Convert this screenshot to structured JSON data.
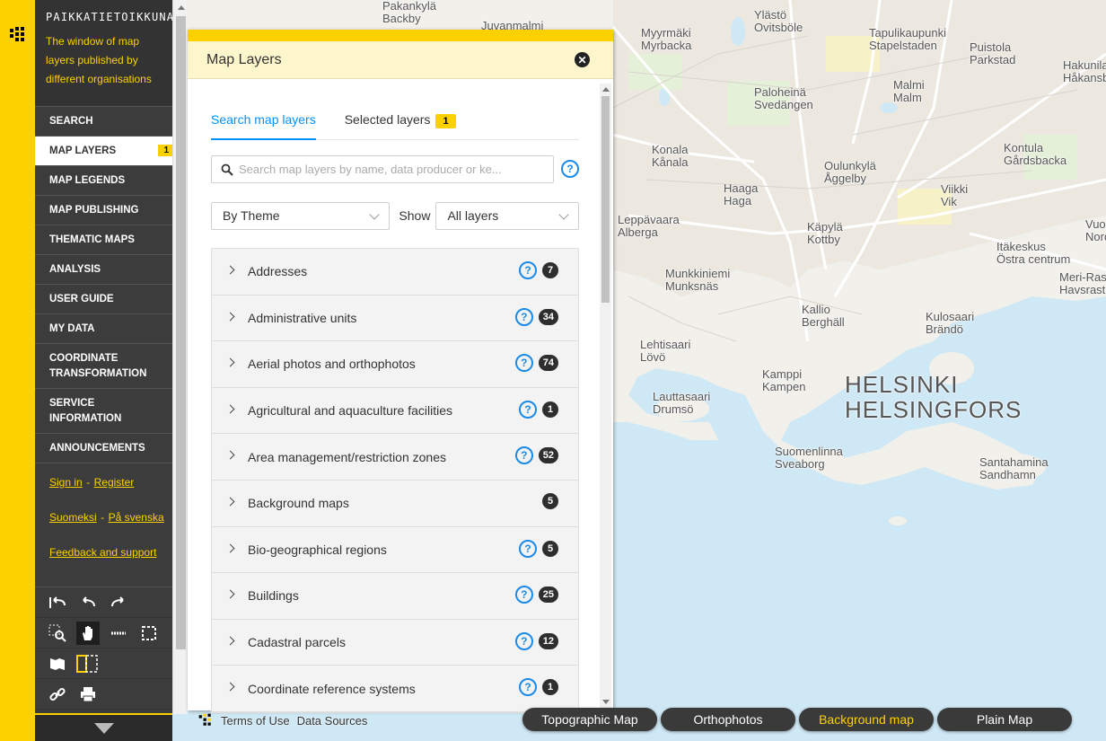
{
  "app": {
    "brand_title": "PAIKKATIETOIKKUNA",
    "brand_description": "The window of map layers published by different organisations"
  },
  "nav": {
    "items": [
      {
        "label": "SEARCH"
      },
      {
        "label": "MAP LAYERS",
        "badge": "1"
      },
      {
        "label": "MAP LEGENDS"
      },
      {
        "label": "MAP PUBLISHING"
      },
      {
        "label": "THEMATIC MAPS"
      },
      {
        "label": "ANALYSIS"
      },
      {
        "label": "USER GUIDE"
      },
      {
        "label": "MY DATA"
      },
      {
        "label": "COORDINATE TRANSFORMATION"
      },
      {
        "label": "SERVICE INFORMATION"
      },
      {
        "label": "ANNOUNCEMENTS"
      }
    ],
    "sign_in": "Sign in",
    "register": "Register",
    "lang_fi": "Suomeksi",
    "lang_sv": "På svenska",
    "feedback": "Feedback and support",
    "link_separator": "-"
  },
  "panel": {
    "title": "Map Layers",
    "tab_search": "Search map layers",
    "tab_selected": "Selected layers",
    "tab_selected_count": "1",
    "search_placeholder": "Search map layers by name, data producer or ke...",
    "group_by": "By Theme",
    "show_label": "Show",
    "show_value": "All layers",
    "groups": [
      {
        "name": "Addresses",
        "count": "7",
        "help": true
      },
      {
        "name": "Administrative units",
        "count": "34",
        "help": true
      },
      {
        "name": "Aerial photos and orthophotos",
        "count": "74",
        "help": true
      },
      {
        "name": "Agricultural and aquaculture facilities",
        "count": "1",
        "help": true
      },
      {
        "name": "Area management/restriction zones",
        "count": "52",
        "help": true
      },
      {
        "name": "Background maps",
        "count": "5",
        "help": false
      },
      {
        "name": "Bio-geographical regions",
        "count": "5",
        "help": true
      },
      {
        "name": "Buildings",
        "count": "25",
        "help": true
      },
      {
        "name": "Cadastral parcels",
        "count": "12",
        "help": true
      },
      {
        "name": "Coordinate reference systems",
        "count": "1",
        "help": true
      }
    ]
  },
  "footer": {
    "terms": "Terms of Use",
    "sources": "Data Sources"
  },
  "basemaps": [
    {
      "label": "Topographic Map",
      "active": false
    },
    {
      "label": "Orthophotos",
      "active": false
    },
    {
      "label": "Background map",
      "active": true
    },
    {
      "label": "Plain Map",
      "active": false
    }
  ],
  "map": {
    "places": [
      "Pakankylä Backby",
      "Juvanmalmi",
      "Myyrmäki Myrbacka",
      "Ylästö Ovitsböle",
      "Tapulikaupunki Stapelstaden",
      "Puistola Parkstad",
      "Hakunila Håkansböle",
      "Malmi Malm",
      "Paloheinä Svedängen",
      "Konala Kånala",
      "Oulunkylä Åggelby",
      "Kontula Gårdsbacka",
      "Haaga Haga",
      "Viikki Vik",
      "Leppävaara Alberga",
      "Käpylä Kottby",
      "Vuosaari Nordsjö",
      "Itäkeskus Östra centrum",
      "Meri-Rastila Havsrastböle",
      "Munkkiniemi Munksnäs",
      "Kallio Berghäll",
      "Kulosaari Brändö",
      "Lehtisaari Lövö",
      "Kamppi Kampen",
      "HELSINKI HELSINGFORS",
      "Lauttasaari Drumsö",
      "Suomenlinna Sveaborg",
      "Santahamina Sandhamn"
    ]
  },
  "colors": {
    "accent": "#fdd100",
    "sidebar": "#3c3c3c",
    "link_blue": "#0091ff",
    "water": "#cfe8f5"
  }
}
